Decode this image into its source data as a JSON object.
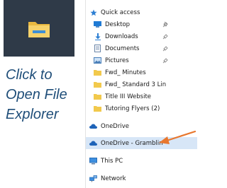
{
  "caption": {
    "line1": "Click to",
    "line2": "Open File",
    "line3": "Explorer"
  },
  "nav": {
    "quick_access": "Quick access",
    "desktop": "Desktop",
    "downloads": "Downloads",
    "documents": "Documents",
    "pictures": "Pictures",
    "fwd_minutes": "Fwd_ Minutes",
    "fwd_standard": "Fwd_ Standard 3 Lin",
    "title3": "Title III Website",
    "tutoring": "Tutoring Flyers (2)",
    "onedrive": "OneDrive",
    "onedrive_org": "OneDrive - Gramblin",
    "this_pc": "This PC",
    "network": "Network"
  },
  "colors": {
    "tile_bg": "#2f3a48",
    "caption": "#1f4e79",
    "highlight": "#d7e6f7",
    "arrow": "#e8772e",
    "folder": "#f2c94c"
  }
}
